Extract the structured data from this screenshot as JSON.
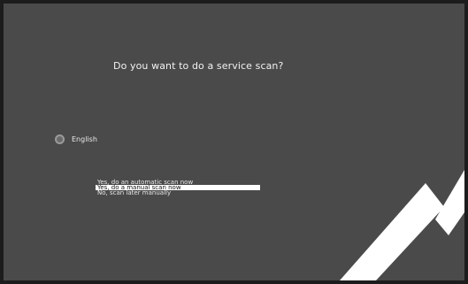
{
  "dialog": {
    "title": "Do you want to do a service scan?"
  },
  "language": {
    "label": "English",
    "icon": "globe-icon"
  },
  "scan_options": [
    {
      "label": "Yes, do an automatic scan now",
      "selected": false
    },
    {
      "label": "Yes, do a manual scan now",
      "selected": true
    },
    {
      "label": "No, scan later manually",
      "selected": false
    }
  ],
  "colors": {
    "background": "#4a4a4a",
    "border": "#1c1c1c",
    "highlight": "#ffffff"
  }
}
